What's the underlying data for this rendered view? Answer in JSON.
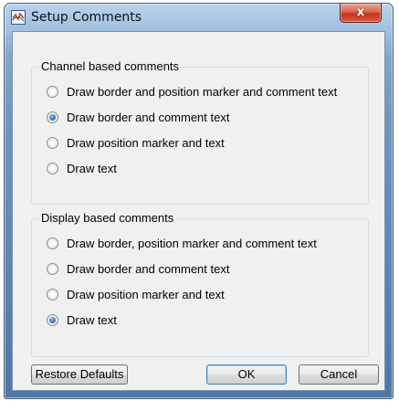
{
  "window": {
    "title": "Setup Comments",
    "close_label": "x"
  },
  "channel_group": {
    "legend": "Channel based comments",
    "options": [
      {
        "label": "Draw border and position marker and comment text",
        "checked": false
      },
      {
        "label": "Draw border and comment text",
        "checked": true
      },
      {
        "label": "Draw position marker and text",
        "checked": false
      },
      {
        "label": "Draw text",
        "checked": false
      }
    ]
  },
  "display_group": {
    "legend": "Display based comments",
    "options": [
      {
        "label": "Draw border, position marker and comment text",
        "checked": false
      },
      {
        "label": "Draw border and comment text",
        "checked": false
      },
      {
        "label": "Draw position marker and text",
        "checked": false
      },
      {
        "label": "Draw text",
        "checked": true
      }
    ]
  },
  "buttons": {
    "restore": "Restore Defaults",
    "ok": "OK",
    "cancel": "Cancel"
  },
  "icons": {
    "app": "waveform-icon",
    "close": "close-icon"
  },
  "colors": {
    "title_bar": "#9ebedf",
    "close_button": "#c2371d",
    "client_bg": "#f0f0f0",
    "radio_selected": "#3b79bd"
  }
}
